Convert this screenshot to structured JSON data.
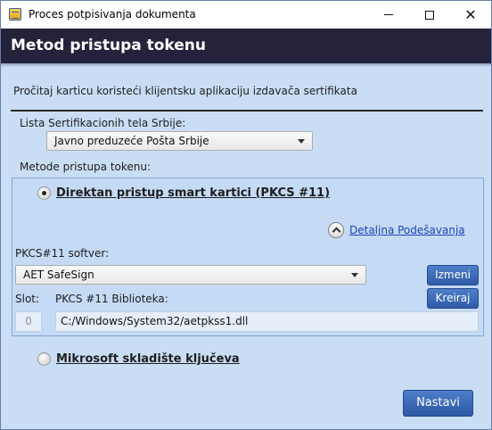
{
  "window": {
    "title": "Proces potpisivanja dokumenta",
    "controls": {
      "minimize": "—",
      "maximize": "☐",
      "close": "✕"
    }
  },
  "header": {
    "title": "Metod pristupa tokenu"
  },
  "instruction": "Pročitaj karticu koristeći klijentsku aplikaciju izdavača sertifikata",
  "ca_list": {
    "label": "Lista Sertifikacionih tela Srbije:",
    "selected": "Javno preduzeće Pošta Srbije"
  },
  "access_methods": {
    "label": "Metode pristupa tokenu:",
    "direct": {
      "label": "Direktan pristup smart kartici (PKCS #11)",
      "checked": true
    },
    "microsoft": {
      "label": "Mikrosoft skladište ključeva",
      "checked": false
    }
  },
  "details": {
    "link": "Detaljna Podešavanja"
  },
  "pkcs": {
    "software_label": "PKCS#11 softver:",
    "software_selected": "AET SafeSign",
    "edit_button": "Izmeni",
    "slot_label": "Slot:",
    "library_label": "PKCS #11 Biblioteka:",
    "create_button": "Kreiraj",
    "slot_value": "0",
    "library_path": "C:/Windows/System32/aetpkss1.dll"
  },
  "footer": {
    "next_button": "Nastavi"
  },
  "colors": {
    "header_bg": "#24233b",
    "body_bg": "#c9def4",
    "button_blue": "#3a68b5",
    "link_blue": "#1a44b8"
  }
}
